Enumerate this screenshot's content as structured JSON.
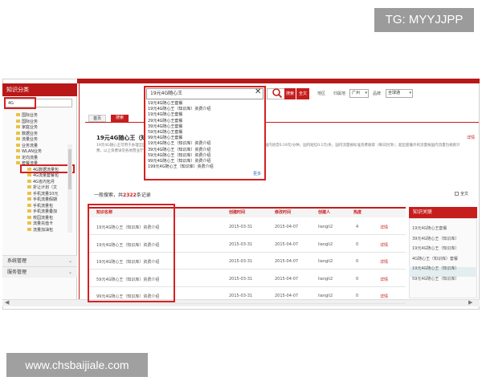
{
  "watermarks": {
    "top": "TG: MYYJJPP",
    "bottom": "www.chsbaijiale.com"
  },
  "sidebar": {
    "title": "知识分类",
    "search_value": "4G",
    "tree": [
      {
        "label": "国际业务",
        "indent": 1
      },
      {
        "label": "国际业务",
        "indent": 1
      },
      {
        "label": "家庭业务",
        "indent": 1
      },
      {
        "label": "数据业务",
        "indent": 1
      },
      {
        "label": "流量业务",
        "indent": 1
      },
      {
        "label": "业务流量",
        "indent": 1
      },
      {
        "label": "WLAN业务",
        "indent": 1
      },
      {
        "label": "定向流量",
        "indent": 1
      },
      {
        "label": "套餐流量",
        "indent": 1
      },
      {
        "label": "4G数据流量包",
        "indent": 2
      },
      {
        "label": "4G流量套餐包",
        "indent": 2
      },
      {
        "label": "4G省内包月",
        "indent": 2
      },
      {
        "label": "折让计划（文",
        "indent": 2
      },
      {
        "label": "手机流量10元",
        "indent": 2
      },
      {
        "label": "手机流量假期",
        "indent": 2
      },
      {
        "label": "手机流量包",
        "indent": 2
      },
      {
        "label": "手机流量叠加",
        "indent": 2
      },
      {
        "label": "校园流量包",
        "indent": 2
      },
      {
        "label": "流量充值卡",
        "indent": 2
      },
      {
        "label": "流量加油包",
        "indent": 2
      }
    ],
    "sections": [
      "系统管理",
      "服务管理"
    ]
  },
  "toolbar": {
    "search_btn": "搜索",
    "fulltext_btn": "全文",
    "area_label": "地区",
    "city_label": "归属地",
    "city_value": "广州",
    "brand_label": "品牌",
    "brand_value": "全球通"
  },
  "dropdown": {
    "input_value": "19元4G随心王",
    "items": [
      "19元4G随心王套餐",
      "19元4G随心王（知识库）资费介绍",
      "19元4G随心王套餐",
      "29元4G随心王套餐",
      "39元4G随心王套餐",
      "59元4G随心王套餐",
      "99元4G随心王套餐",
      "19元4G随心王（知识库）资费介绍",
      "39元4G随心王（知识库）资费介绍",
      "59元4G随心王（知识库）资费介绍",
      "99元4G随心王（知识库）资费介绍",
      "199元4G随心王（知识库）资费介绍"
    ],
    "more": "更多"
  },
  "tabs": {
    "home": "首页",
    "search": "搜索"
  },
  "article": {
    "title": "19元4G随心王（知识库）资费介绍",
    "body": "19元4G随心王可用于办理全国通用流量1GB、国内通话100分钟、国内短信100条，含来电显示；超出后国内语音0.19元/分钟，国内短信0.1元/条，国内流量按标准资费收取（每日封顶）；超出套餐外的流量按国内流量包规则计费，以上资费详见各地营业厅公布的业务规则及国内流量资费说明（适用于全国范围内使用）。",
    "detail": "详情"
  },
  "results": {
    "prefix": "一般搜索，共",
    "count": "2322",
    "suffix": "条记录",
    "fulltext_label": "全文"
  },
  "table": {
    "headers": {
      "name": "知识名称",
      "created": "创建时间",
      "modified": "修改时间",
      "creator": "创建人",
      "hot": "热度"
    },
    "rows": [
      {
        "name": "19元4G随心王（知识库）资费介绍",
        "created": "2015-03-31",
        "modified": "2015-04-07",
        "creator": "liangli2",
        "hot": "4",
        "action": "详情"
      },
      {
        "name": "19元4G随心王（知识库）资费介绍",
        "created": "2015-03-31",
        "modified": "2015-04-07",
        "creator": "liangli2",
        "hot": "0",
        "action": "详情"
      },
      {
        "name": "19元4G随心王（知识库）资费介绍",
        "created": "2015-03-31",
        "modified": "2015-04-07",
        "creator": "liangli2",
        "hot": "0",
        "action": "详情"
      },
      {
        "name": "59元4G随心王（知识库）资费介绍",
        "created": "2015-03-31",
        "modified": "2015-04-07",
        "creator": "liangli2",
        "hot": "0",
        "action": "详情"
      },
      {
        "name": "99元4G随心王（知识库）资费介绍",
        "created": "2015-03-31",
        "modified": "2015-04-07",
        "creator": "liangli2",
        "hot": "0",
        "action": "详情"
      }
    ]
  },
  "related": {
    "title": "知识关联",
    "items": [
      "19元4G随心王套餐",
      "39元4G随心王（知识库）",
      "19元4G随心王（知识库）",
      "4G随心王（知识库）套餐",
      "19元4G随心王（知识库）",
      "59元4G随心王（知识库）"
    ]
  },
  "colors": {
    "brand_red": "#c61d1d",
    "highlight_red": "#d62020",
    "link_blue": "#2a6ec0"
  }
}
